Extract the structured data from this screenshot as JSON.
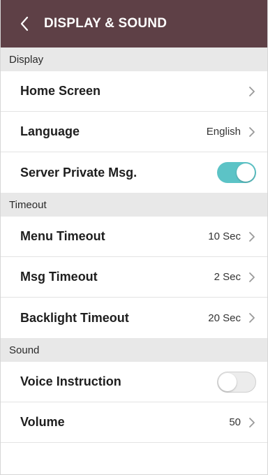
{
  "header": {
    "title": "DISPLAY & SOUND",
    "back_icon": "chevron-left-icon"
  },
  "sections": {
    "display": {
      "label": "Display",
      "home_screen": {
        "label": "Home Screen"
      },
      "language": {
        "label": "Language",
        "value": "English"
      },
      "server_private_msg": {
        "label": "Server Private Msg.",
        "enabled": true
      }
    },
    "timeout": {
      "label": "Timeout",
      "menu_timeout": {
        "label": "Menu Timeout",
        "value": "10 Sec"
      },
      "msg_timeout": {
        "label": "Msg Timeout",
        "value": "2 Sec"
      },
      "backlight_timeout": {
        "label": "Backlight Timeout",
        "value": "20 Sec"
      }
    },
    "sound": {
      "label": "Sound",
      "voice_instruction": {
        "label": "Voice Instruction",
        "enabled": false
      },
      "volume": {
        "label": "Volume",
        "value": "50"
      }
    }
  },
  "colors": {
    "header_bg": "#5e4046",
    "section_bg": "#e8e8e8",
    "toggle_on": "#5cc3c6",
    "toggle_off": "#ececec",
    "chevron": "#9a9a9a"
  }
}
